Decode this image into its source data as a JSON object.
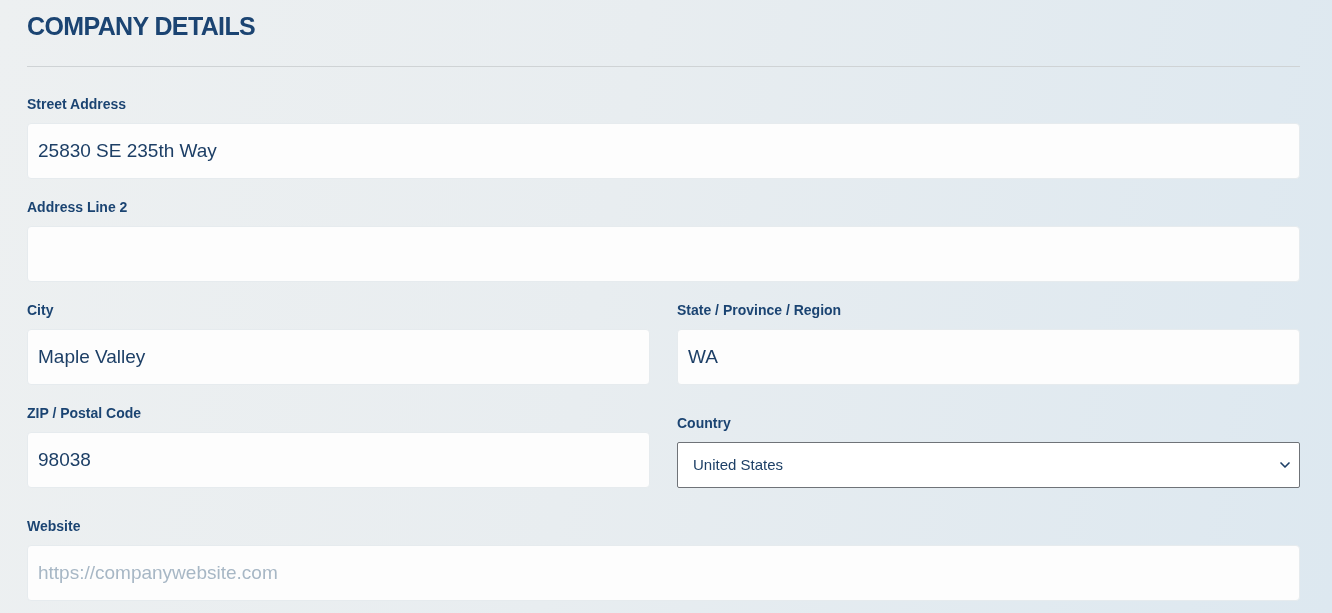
{
  "heading": "COMPANY DETAILS",
  "rows": [
    [
      {
        "kind": "text",
        "label": "Street Address",
        "value": "25830 SE 235th Way"
      }
    ],
    [
      {
        "kind": "text",
        "label": "Address Line 2"
      }
    ],
    [
      {
        "kind": "text",
        "label": "City",
        "value": "Maple Valley"
      },
      {
        "kind": "text",
        "label": "State / Province / Region",
        "value": "WA"
      }
    ],
    [
      {
        "kind": "text",
        "label": "ZIP / Postal Code",
        "value": "98038"
      },
      {
        "kind": "select",
        "label": "Country",
        "value": "United States"
      }
    ],
    [
      {
        "kind": "text",
        "label": "Website",
        "placeholder": "https://companywebsite.com"
      }
    ]
  ]
}
